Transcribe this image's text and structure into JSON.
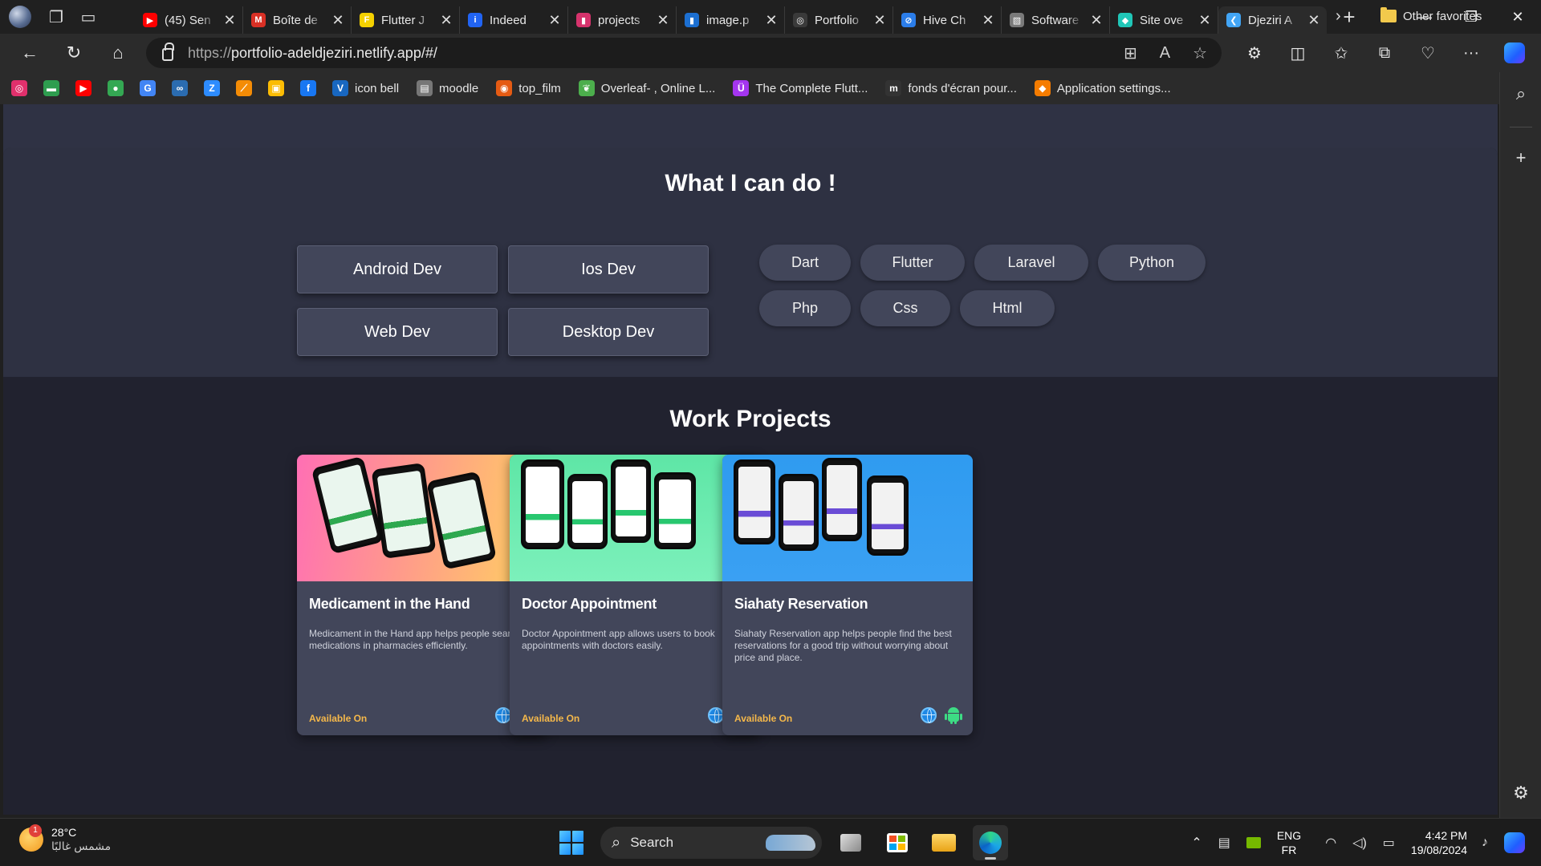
{
  "browser": {
    "tabs": [
      {
        "title": "(45) Sen",
        "icon": "youtube-icon",
        "color": "#ff0000",
        "glyph": "▶"
      },
      {
        "title": "Boîte de",
        "icon": "gmail-icon",
        "color": "#d93025",
        "glyph": "M"
      },
      {
        "title": "Flutter J",
        "icon": "flutter-jobs-icon",
        "color": "#f4d100",
        "glyph": "F"
      },
      {
        "title": "Indeed",
        "icon": "indeed-icon",
        "color": "#2164f3",
        "glyph": "i"
      },
      {
        "title": "projects",
        "icon": "trello-icon",
        "color": "#d6336c",
        "glyph": "▮"
      },
      {
        "title": "image.p",
        "icon": "trello-icon",
        "color": "#1c6fd1",
        "glyph": "▮"
      },
      {
        "title": "Portfolio",
        "icon": "chatgpt-icon",
        "color": "#3a3a3a",
        "glyph": "◎"
      },
      {
        "title": "Hive Ch",
        "icon": "hive-icon",
        "color": "#2b7de9",
        "glyph": "⊘"
      },
      {
        "title": "Software",
        "icon": "image-icon",
        "color": "#7a7a7a",
        "glyph": "▧"
      },
      {
        "title": "Site ove",
        "icon": "netlify-icon",
        "color": "#20c6b7",
        "glyph": "◆"
      },
      {
        "title": "Djeziri A",
        "icon": "flutter-icon",
        "color": "#42a5f5",
        "glyph": "❮"
      }
    ],
    "active_tab_index": 10,
    "url_scheme": "https://",
    "url_host": "portfolio-adeldjeziri.netlify.app/#/",
    "favorites": [
      {
        "label": "",
        "icon": "instagram-icon",
        "color": "#e1306c",
        "glyph": "◎"
      },
      {
        "label": "",
        "icon": "green-bookmark-icon",
        "color": "#2e9d4f",
        "glyph": "▬"
      },
      {
        "label": "",
        "icon": "youtube-icon",
        "color": "#ff0000",
        "glyph": "▶"
      },
      {
        "label": "",
        "icon": "google-maps-icon",
        "color": "#34a853",
        "glyph": "●"
      },
      {
        "label": "",
        "icon": "google-translate-icon",
        "color": "#4285f4",
        "glyph": "G"
      },
      {
        "label": "",
        "icon": "deepl-icon",
        "color": "#2b6cb0",
        "glyph": "∞"
      },
      {
        "label": "",
        "icon": "zoom-icon",
        "color": "#2d8cff",
        "glyph": "Z"
      },
      {
        "label": "",
        "icon": "kotlin-icon",
        "color": "#f48c06",
        "glyph": "⟋"
      },
      {
        "label": "",
        "icon": "photos-icon",
        "color": "#fbbc04",
        "glyph": "▣"
      },
      {
        "label": "",
        "icon": "facebook-icon",
        "color": "#1877f2",
        "glyph": "f"
      },
      {
        "label": "icon bell",
        "icon": "vuetify-icon",
        "color": "#1867c0",
        "glyph": "V"
      },
      {
        "label": "moodle",
        "icon": "moodle-icon",
        "color": "#777777",
        "glyph": "▤"
      },
      {
        "label": "top_film",
        "icon": "film-icon",
        "color": "#e55b13",
        "glyph": "◉"
      },
      {
        "label": "Overleaf- , Online L...",
        "icon": "overleaf-icon",
        "color": "#4cae4c",
        "glyph": "❦"
      },
      {
        "label": "The Complete Flutt...",
        "icon": "udemy-icon",
        "color": "#a435f0",
        "glyph": "Ü"
      },
      {
        "label": "fonds d'écran pour...",
        "icon": "medium-icon",
        "color": "#333333",
        "glyph": "m"
      },
      {
        "label": "Application settings...",
        "icon": "firebase-icon",
        "color": "#f57c00",
        "glyph": "◆"
      }
    ],
    "other_favorites": "Other favorites"
  },
  "page": {
    "services_title": "What I can do !",
    "services": [
      "Android Dev",
      "Ios Dev",
      "Web Dev",
      "Desktop Dev"
    ],
    "skills": [
      "Dart",
      "Flutter",
      "Laravel",
      "Python",
      "Php",
      "Css",
      "Html"
    ],
    "projects_title": "Work Projects",
    "projects": [
      {
        "title": "Medicament in the Hand",
        "description": "Medicament in the Hand app helps people search for medications in pharmacies efficiently.",
        "footer": "Available On",
        "bg": "linear-gradient(100deg,#ff6fb4 0%,#ff9a8b 45%,#ffd45e 100%)",
        "screen_color": "#eaf6ee",
        "accent": "#2ea84f"
      },
      {
        "title": "Doctor Appointment",
        "description": "Doctor Appointment app allows users to book appointments with doctors easily.",
        "footer": "Available On",
        "bg": "linear-gradient(180deg,#5ee6a6 0%,#7cf0bb 100%)",
        "screen_color": "#ffffff",
        "accent": "#28c76f"
      },
      {
        "title": "Siahaty Reservation",
        "description": "Siahaty Reservation app helps people find the best reservations for a good trip without worrying about price and place.",
        "footer": "Available On",
        "bg": "linear-gradient(180deg,#2f9bf0 0%,#3aa0f3 100%)",
        "screen_color": "#f2f2f2",
        "accent": "#6a4cd6"
      }
    ]
  },
  "taskbar": {
    "temperature": "28°C",
    "weather_desc": "مشمس غالبًا",
    "weather_badge": "1",
    "search_placeholder": "Search",
    "lang_top": "ENG",
    "lang_bottom": "FR",
    "time": "4:42 PM",
    "date": "19/08/2024"
  },
  "colors": {
    "page_bg": "#2f3244",
    "card_bg": "#42465a",
    "footer_accent": "#f5b84a",
    "android_green": "#3ddc84",
    "web_blue": "#1e88e5"
  }
}
